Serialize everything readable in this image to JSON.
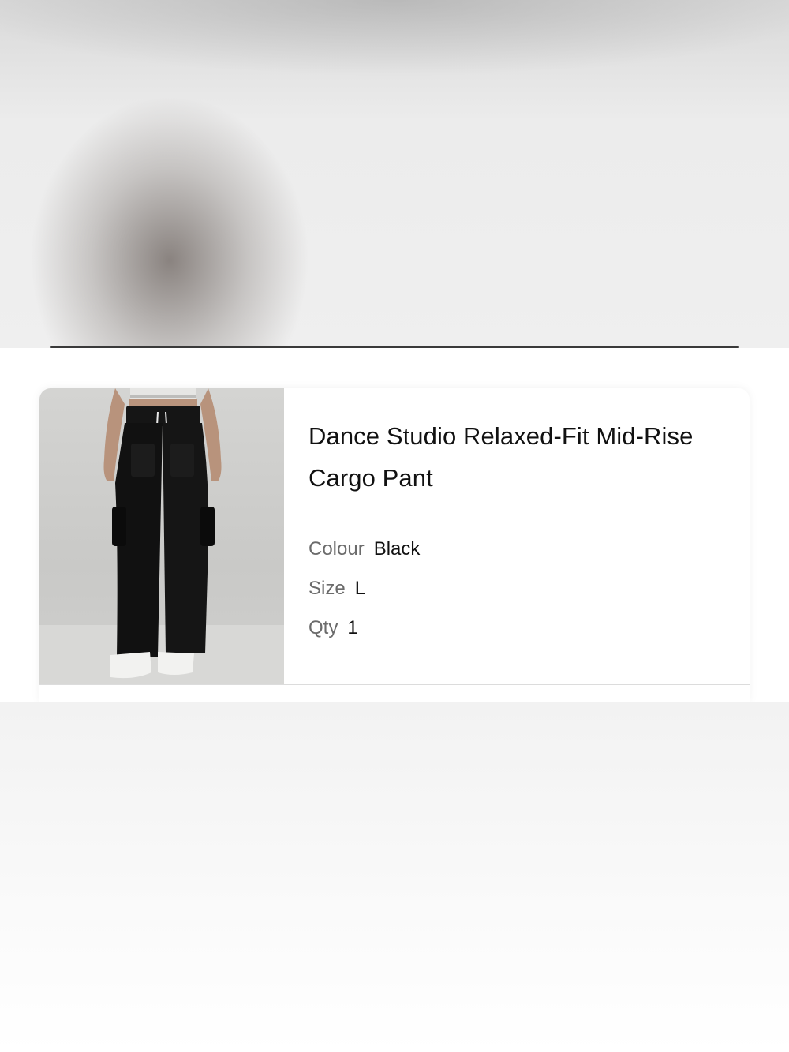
{
  "colors": {
    "card_background": "#ffffff",
    "label_gray": "#6b6b6b",
    "text_dark": "#111111",
    "product_color": "#111111"
  },
  "order_item": {
    "title": "Dance Studio Relaxed-Fit Mid-Rise Cargo Pant",
    "image_icon": "product-photo",
    "attributes": {
      "colour_label": "Colour",
      "colour_value": "Black",
      "size_label": "Size",
      "size_value": "L",
      "qty_label": "Qty",
      "qty_value": "1"
    }
  }
}
